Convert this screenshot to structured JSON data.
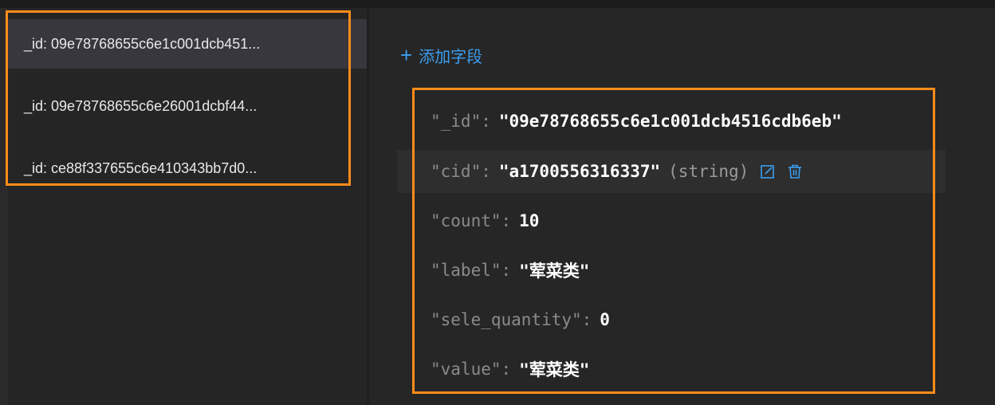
{
  "documents": [
    {
      "label": "_id: 09e78768655c6e1c001dcb451..."
    },
    {
      "label": "_id: 09e78768655c6e26001dcbf44..."
    },
    {
      "label": "_id: ce88f337655c6e410343bb7d0..."
    }
  ],
  "toolbar": {
    "add_field_label": "添加字段",
    "plus_icon": "plus-icon"
  },
  "fields": [
    {
      "key": "\"_id\":",
      "value": "\"09e78768655c6e1c001dcb4516cdb6eb\""
    },
    {
      "key": "\"cid\":",
      "value": "\"a1700556316337\"",
      "type": "(string)"
    },
    {
      "key": "\"count\":",
      "value": "10"
    },
    {
      "key": "\"label\":",
      "value": "\"荤菜类\""
    },
    {
      "key": "\"sele_quantity\":",
      "value": "0"
    },
    {
      "key": "\"value\":",
      "value": "\"荤菜类\""
    }
  ],
  "colors": {
    "accent": "#3c9ef0",
    "highlight": "#ff8c1a"
  }
}
